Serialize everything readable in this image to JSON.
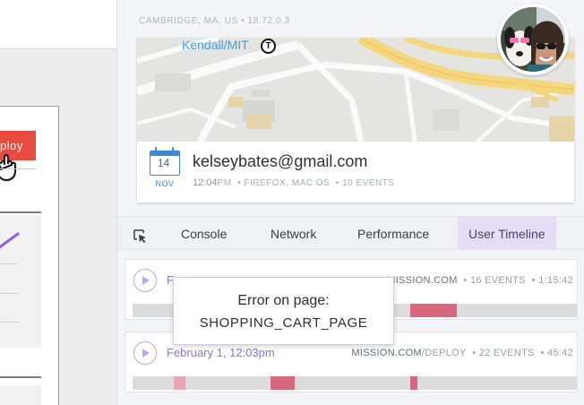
{
  "left_app": {
    "deploy_label": "ploy"
  },
  "location": {
    "city": "CAMBRIDGE, MA, US",
    "separator": "•",
    "ip": "18.72.0.3"
  },
  "map": {
    "station_label": "Kendall/MIT",
    "transit_icon_letter": "T"
  },
  "session": {
    "calendar_day": "14",
    "calendar_month": "NOV",
    "email": "kelseybates@gmail.com",
    "time": "12:04",
    "time_suffix": "PM",
    "browser": "FIREFOX, MAC OS",
    "events": "10 EVENTS"
  },
  "tabs": {
    "items": [
      "Console",
      "Network",
      "Performance",
      "User Timeline"
    ],
    "active": "User Timeline"
  },
  "rows": [
    {
      "date": "F",
      "url": "MISSION.COM",
      "events": "16 EVENTS",
      "duration": "1:15:42"
    },
    {
      "date": "February 1, 12:03pm",
      "url": "MISSION.COM",
      "url_path": "/DEPLOY",
      "events": "22 EVENTS",
      "duration": "45:42"
    }
  ],
  "tooltip": {
    "line1": "Error on page:",
    "line2": "SHOPPING_CART_PAGE"
  },
  "colors": {
    "accent_purple": "#8e72d4",
    "active_tab_bg": "#e5ddf7",
    "deploy_red": "#ea4b3f",
    "error_mark": "#d9677d",
    "map_road_yellow": "#f5d67a",
    "link_blue": "#3ba0e6"
  },
  "icons": {
    "inspector": "cursor-select-icon",
    "calendar": "calendar-icon",
    "play": "play-icon",
    "hand": "hand-cursor-icon",
    "transit": "transit-t-icon"
  }
}
